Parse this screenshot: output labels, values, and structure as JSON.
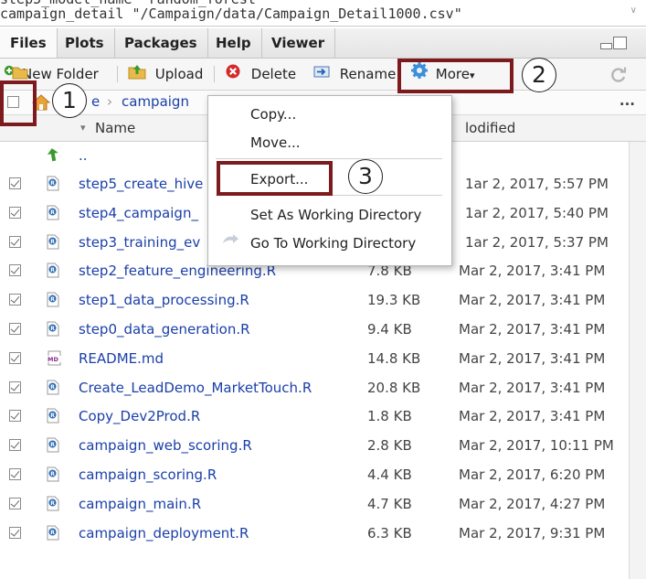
{
  "console_lines": [
    "  step5_model_name  \"random_forest\"",
    "  campaign_detail   \"/Campaign/data/Campaign_Detail1000.csv\""
  ],
  "tabs": [
    {
      "label": "Files",
      "active": true
    },
    {
      "label": "Plots"
    },
    {
      "label": "Packages"
    },
    {
      "label": "Help"
    },
    {
      "label": "Viewer"
    }
  ],
  "toolbar": {
    "new_folder": "New Folder",
    "upload": "Upload",
    "delete": "Delete",
    "rename": "Rename",
    "more": "More",
    "more_caret": "▾",
    "overflow": "..."
  },
  "breadcrumb": {
    "home_fragment": "e",
    "folder": "campaign",
    "separator": "›"
  },
  "columns": {
    "name": "Name",
    "sort_indicator": "▾",
    "modified": "Modified",
    "modified_visible": "lodified"
  },
  "parent_dir": "..",
  "files": [
    {
      "name": "step5_create_hive",
      "size": "",
      "modified": "Mar 2, 2017, 5:57 PM",
      "visible_modified": "1ar 2, 2017, 5:57 PM",
      "type": "R"
    },
    {
      "name": "step4_campaign_",
      "size": "",
      "modified": "Mar 2, 2017, 5:40 PM",
      "visible_modified": "1ar 2, 2017, 5:40 PM",
      "type": "R"
    },
    {
      "name": "step3_training_ev",
      "size": "",
      "modified": "Mar 2, 2017, 5:37 PM",
      "visible_modified": "1ar 2, 2017, 5:37 PM",
      "type": "R"
    },
    {
      "name": "step2_feature_engineering.R",
      "size": "7.8 KB",
      "modified": "Mar 2, 2017, 3:41 PM",
      "type": "R"
    },
    {
      "name": "step1_data_processing.R",
      "size": "19.3 KB",
      "modified": "Mar 2, 2017, 3:41 PM",
      "type": "R"
    },
    {
      "name": "step0_data_generation.R",
      "size": "9.4 KB",
      "modified": "Mar 2, 2017, 3:41 PM",
      "type": "R"
    },
    {
      "name": "README.md",
      "size": "14.8 KB",
      "modified": "Mar 2, 2017, 3:41 PM",
      "type": "MD"
    },
    {
      "name": "Create_LeadDemo_MarketTouch.R",
      "size": "20.8 KB",
      "modified": "Mar 2, 2017, 3:41 PM",
      "type": "R"
    },
    {
      "name": "Copy_Dev2Prod.R",
      "size": "1.8 KB",
      "modified": "Mar 2, 2017, 3:41 PM",
      "type": "R"
    },
    {
      "name": "campaign_web_scoring.R",
      "size": "2.8 KB",
      "modified": "Mar 2, 2017, 10:11 PM",
      "type": "R"
    },
    {
      "name": "campaign_scoring.R",
      "size": "4.4 KB",
      "modified": "Mar 2, 2017, 6:20 PM",
      "type": "R"
    },
    {
      "name": "campaign_main.R",
      "size": "4.7 KB",
      "modified": "Mar 2, 2017, 4:27 PM",
      "type": "R"
    },
    {
      "name": "campaign_deployment.R",
      "size": "6.3 KB",
      "modified": "Mar 2, 2017, 9:31 PM",
      "type": "R"
    }
  ],
  "md_badge": "MD",
  "more_menu": {
    "copy": "Copy...",
    "move": "Move...",
    "export": "Export...",
    "set_wd": "Set As Working Directory",
    "go_wd": "Go To Working Directory"
  },
  "annotations": {
    "one": "1",
    "two": "2",
    "three": "3"
  },
  "colors": {
    "highlight": "#7d1a1e",
    "file_link": "#1a3fa8",
    "r_icon": "#2d6db5",
    "parent_arrow": "#3a9a2e"
  }
}
